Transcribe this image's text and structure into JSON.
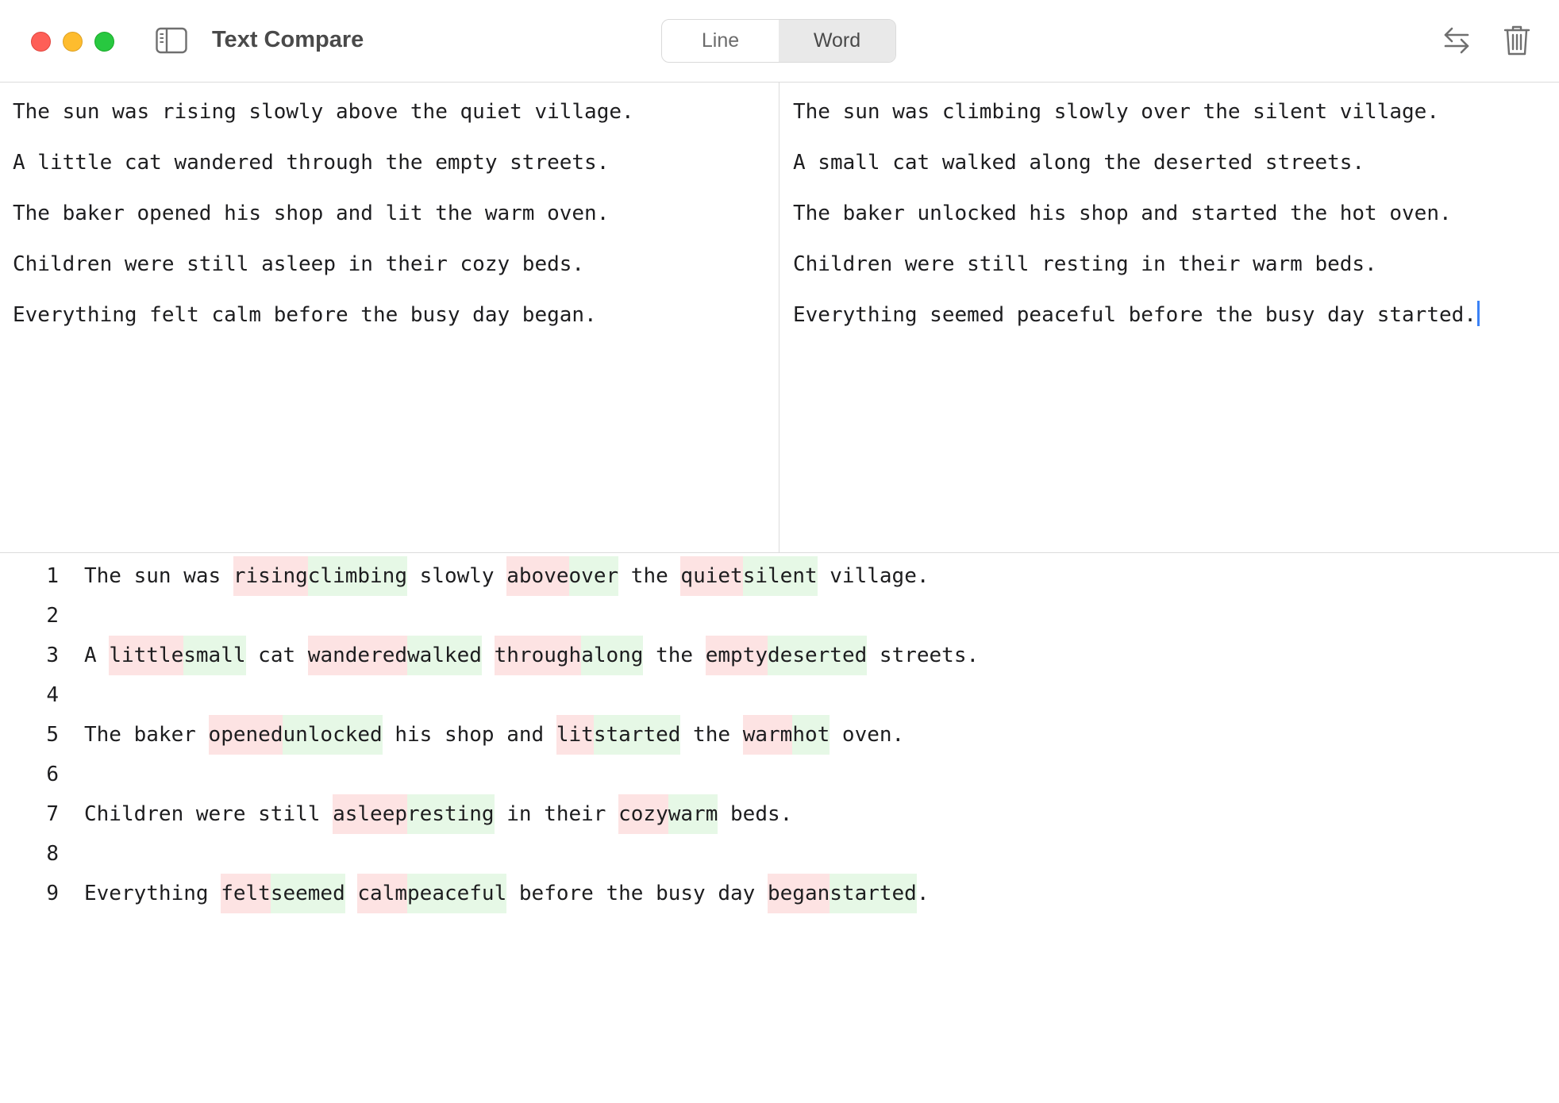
{
  "app": {
    "title": "Text Compare"
  },
  "mode_toggle": {
    "options": [
      "Line",
      "Word"
    ],
    "selected": "Word"
  },
  "colors": {
    "deleted_bg": "#fde3e3",
    "inserted_bg": "#e6f8e6",
    "caret": "#3b82f6"
  },
  "icons": {
    "sidebar": "sidebar-toggle-icon",
    "swap": "swap-arrows-icon",
    "clear": "trash-icon"
  },
  "left_pane": {
    "lines": [
      "The sun was rising slowly above the quiet village.",
      "A little cat wandered through the empty streets.",
      "The baker opened his shop and lit the warm oven.",
      "Children were still asleep in their cozy beds.",
      "Everything felt calm before the busy day began."
    ]
  },
  "right_pane": {
    "lines": [
      "The sun was climbing slowly over the silent village.",
      "A small cat walked along the deserted streets.",
      "The baker unlocked his shop and started the hot oven.",
      "Children were still resting in their warm beds.",
      "Everything seemed peaceful before the busy day started."
    ]
  },
  "diff": {
    "rows": [
      {
        "num": "1",
        "segments": [
          {
            "t": "The sun was ",
            "k": "same"
          },
          {
            "t": "rising",
            "k": "del"
          },
          {
            "t": "climbing",
            "k": "ins"
          },
          {
            "t": " slowly ",
            "k": "same"
          },
          {
            "t": "above",
            "k": "del"
          },
          {
            "t": "over",
            "k": "ins"
          },
          {
            "t": " the ",
            "k": "same"
          },
          {
            "t": "quiet",
            "k": "del"
          },
          {
            "t": "silent",
            "k": "ins"
          },
          {
            "t": " village.",
            "k": "same"
          }
        ]
      },
      {
        "num": "2",
        "segments": []
      },
      {
        "num": "3",
        "segments": [
          {
            "t": "A ",
            "k": "same"
          },
          {
            "t": "little",
            "k": "del"
          },
          {
            "t": "small",
            "k": "ins"
          },
          {
            "t": " cat ",
            "k": "same"
          },
          {
            "t": "wandered",
            "k": "del"
          },
          {
            "t": "walked",
            "k": "ins"
          },
          {
            "t": " ",
            "k": "same"
          },
          {
            "t": "through",
            "k": "del"
          },
          {
            "t": "along",
            "k": "ins"
          },
          {
            "t": " the ",
            "k": "same"
          },
          {
            "t": "empty",
            "k": "del"
          },
          {
            "t": "deserted",
            "k": "ins"
          },
          {
            "t": " streets.",
            "k": "same"
          }
        ]
      },
      {
        "num": "4",
        "segments": []
      },
      {
        "num": "5",
        "segments": [
          {
            "t": "The baker ",
            "k": "same"
          },
          {
            "t": "opened",
            "k": "del"
          },
          {
            "t": "unlocked",
            "k": "ins"
          },
          {
            "t": " his shop and ",
            "k": "same"
          },
          {
            "t": "lit",
            "k": "del"
          },
          {
            "t": "started",
            "k": "ins"
          },
          {
            "t": " the ",
            "k": "same"
          },
          {
            "t": "warm",
            "k": "del"
          },
          {
            "t": "hot",
            "k": "ins"
          },
          {
            "t": " oven.",
            "k": "same"
          }
        ]
      },
      {
        "num": "6",
        "segments": []
      },
      {
        "num": "7",
        "segments": [
          {
            "t": "Children were still ",
            "k": "same"
          },
          {
            "t": "asleep",
            "k": "del"
          },
          {
            "t": "resting",
            "k": "ins"
          },
          {
            "t": " in their ",
            "k": "same"
          },
          {
            "t": "cozy",
            "k": "del"
          },
          {
            "t": "warm",
            "k": "ins"
          },
          {
            "t": " beds.",
            "k": "same"
          }
        ]
      },
      {
        "num": "8",
        "segments": []
      },
      {
        "num": "9",
        "segments": [
          {
            "t": "Everything ",
            "k": "same"
          },
          {
            "t": "felt",
            "k": "del"
          },
          {
            "t": "seemed",
            "k": "ins"
          },
          {
            "t": " ",
            "k": "same"
          },
          {
            "t": "calm",
            "k": "del"
          },
          {
            "t": "peaceful",
            "k": "ins"
          },
          {
            "t": " before the busy day ",
            "k": "same"
          },
          {
            "t": "began",
            "k": "del"
          },
          {
            "t": "started",
            "k": "ins"
          },
          {
            "t": ".",
            "k": "same"
          }
        ]
      }
    ]
  }
}
